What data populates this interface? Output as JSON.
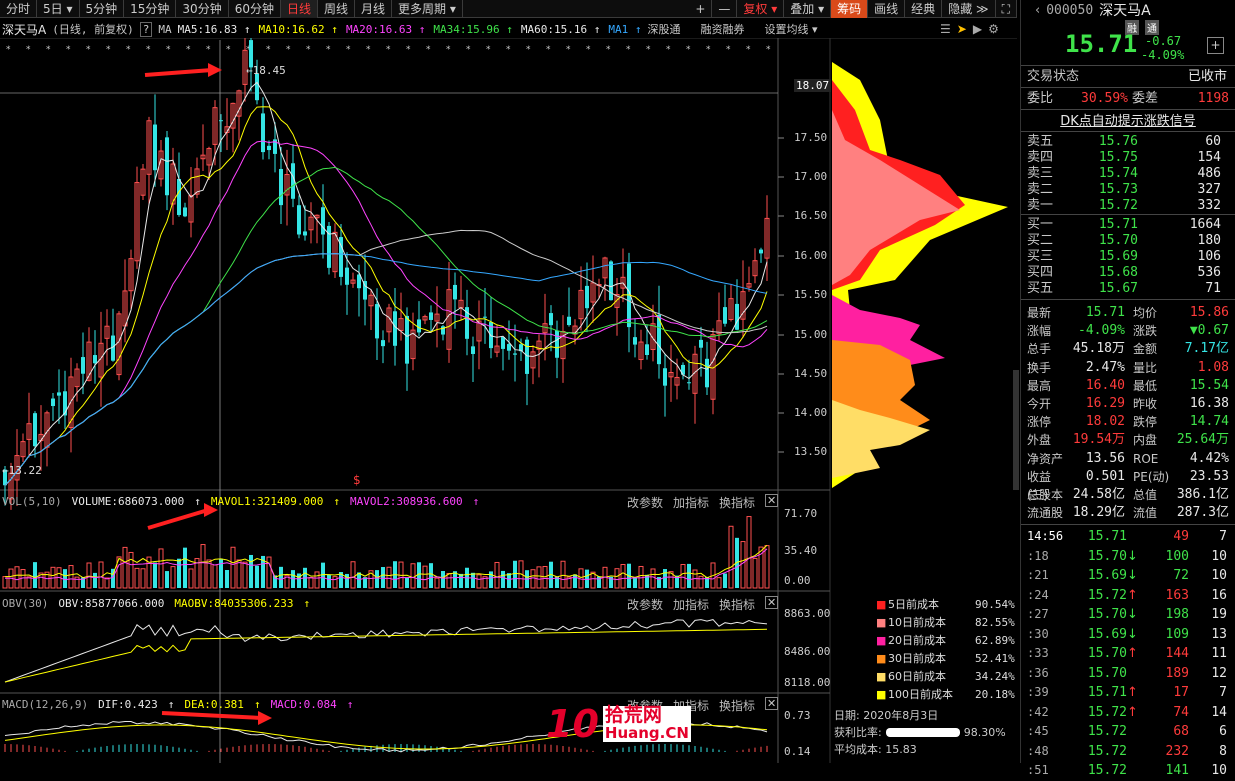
{
  "toolbar": {
    "items": [
      "分时",
      "5日",
      "5分钟",
      "15分钟",
      "30分钟",
      "60分钟",
      "日线",
      "周线",
      "月线",
      "更多周期"
    ],
    "active": "日线",
    "right": [
      "+",
      "—",
      "复权",
      "叠加",
      "筹码",
      "画线",
      "经典",
      "隐藏"
    ]
  },
  "stock": {
    "name": "深天马A",
    "code": "000050",
    "name_right": "深天马A",
    "badges": [
      "融",
      "通"
    ],
    "price": "15.71",
    "change": "-0.67",
    "change_pct": "-4.09%"
  },
  "info_row": {
    "mode": "(日线, 前复权)",
    "ma_label": "MA",
    "ma": [
      {
        "label": "MA5:16.83",
        "color": "#e8e8e8"
      },
      {
        "label": "MA10:16.62",
        "color": "#ffff00"
      },
      {
        "label": "MA20:16.63",
        "color": "#ff44ff"
      },
      {
        "label": "MA34:15.96",
        "color": "#3fe34a"
      },
      {
        "label": "MA60:15.16",
        "color": "#e8e8e8"
      },
      {
        "label": "MA1",
        "color": "#35a8ff"
      }
    ],
    "extra": [
      "深股通",
      "融资融券",
      "设置均线"
    ]
  },
  "price_axis": [
    "18.07",
    "17.50",
    "17.00",
    "16.50",
    "16.00",
    "15.50",
    "15.00",
    "14.50",
    "14.00",
    "13.50"
  ],
  "annotations": {
    "high": "18.45",
    "low": "13.22"
  },
  "vol": {
    "title": "VOL(5,10)",
    "volume": "VOLUME:686073.000",
    "mavol1": "MAVOL1:321409.000",
    "mavol2": "MAVOL2:308936.600",
    "axis": [
      "71.70",
      "35.40",
      "0.00"
    ]
  },
  "obv": {
    "title": "OBV(30)",
    "obv": "OBV:85877066.000",
    "maobv": "MAOBV:84035306.233",
    "axis": [
      "8863.00",
      "8486.00",
      "8118.00"
    ]
  },
  "macd": {
    "title": "MACD(12,26,9)",
    "dif": "DIF:0.423",
    "dea": "DEA:0.381",
    "macd": "MACD:0.084",
    "axis": [
      "0.73",
      "0.14"
    ]
  },
  "panel_buttons": [
    "改参数",
    "加指标",
    "换指标"
  ],
  "cost": {
    "items": [
      {
        "label": "5日前成本",
        "value": "90.54%",
        "color": "#ff2020"
      },
      {
        "label": "10日前成本",
        "value": "82.55%",
        "color": "#ff8080"
      },
      {
        "label": "20日前成本",
        "value": "62.89%",
        "color": "#ff20a0"
      },
      {
        "label": "30日前成本",
        "value": "52.41%",
        "color": "#ff8c1a"
      },
      {
        "label": "60日前成本",
        "value": "34.24%",
        "color": "#ffdd66"
      },
      {
        "label": "100日前成本",
        "value": "20.18%",
        "color": "#ffff00"
      }
    ],
    "date": "日期: 2020年8月3日",
    "profit_label": "获利比率:",
    "profit_value": "98.30%",
    "avg_cost": "平均成本: 15.83"
  },
  "status": {
    "label": "交易状态",
    "value": "已收市"
  },
  "weibi": {
    "l1": "委比",
    "v1": "30.59%",
    "l2": "委差",
    "v2": "1198"
  },
  "dk_signal": "DK点自动提示涨跌信号",
  "asks": [
    {
      "label": "卖五",
      "price": "15.76",
      "vol": "60"
    },
    {
      "label": "卖四",
      "price": "15.75",
      "vol": "154"
    },
    {
      "label": "卖三",
      "price": "15.74",
      "vol": "486"
    },
    {
      "label": "卖二",
      "price": "15.73",
      "vol": "327"
    },
    {
      "label": "卖一",
      "price": "15.72",
      "vol": "332"
    }
  ],
  "bids": [
    {
      "label": "买一",
      "price": "15.71",
      "vol": "1664"
    },
    {
      "label": "买二",
      "price": "15.70",
      "vol": "180"
    },
    {
      "label": "买三",
      "price": "15.69",
      "vol": "106"
    },
    {
      "label": "买四",
      "price": "15.68",
      "vol": "536"
    },
    {
      "label": "买五",
      "price": "15.67",
      "vol": "71"
    }
  ],
  "stats": [
    {
      "l1": "最新",
      "v1": "15.71",
      "c1": "green",
      "l2": "均价",
      "v2": "15.86",
      "c2": "red"
    },
    {
      "l1": "涨幅",
      "v1": "-4.09%",
      "c1": "green",
      "l2": "涨跌",
      "v2": "▼0.67",
      "c2": "green"
    },
    {
      "l1": "总手",
      "v1": "45.18万",
      "c1": "white",
      "l2": "金额",
      "v2": "7.17亿",
      "c2": "cyan"
    },
    {
      "l1": "换手",
      "v1": "2.47%",
      "c1": "white",
      "l2": "量比",
      "v2": "1.08",
      "c2": "red"
    },
    {
      "l1": "最高",
      "v1": "16.40",
      "c1": "red",
      "l2": "最低",
      "v2": "15.54",
      "c2": "green"
    },
    {
      "l1": "今开",
      "v1": "16.29",
      "c1": "red",
      "l2": "昨收",
      "v2": "16.38",
      "c2": "white"
    },
    {
      "l1": "涨停",
      "v1": "18.02",
      "c1": "red",
      "l2": "跌停",
      "v2": "14.74",
      "c2": "green"
    },
    {
      "l1": "外盘",
      "v1": "19.54万",
      "c1": "red",
      "l2": "内盘",
      "v2": "25.64万",
      "c2": "green"
    },
    {
      "l1": "净资产",
      "v1": "13.56",
      "c1": "white",
      "l2": "ROE",
      "v2": "4.42%",
      "c2": "white"
    },
    {
      "l1": "收益(三)",
      "v1": "0.501",
      "c1": "white",
      "l2": "PE(动)",
      "v2": "23.53",
      "c2": "white"
    },
    {
      "l1": "总股本",
      "v1": "24.58亿",
      "c1": "white",
      "l2": "总值",
      "v2": "386.1亿",
      "c2": "white"
    },
    {
      "l1": "流通股",
      "v1": "18.29亿",
      "c1": "white",
      "l2": "流值",
      "v2": "287.3亿",
      "c2": "white"
    }
  ],
  "ticks": [
    {
      "t": "14:56",
      "p": "15.71",
      "a": "",
      "v": "49",
      "n": "7",
      "pc": "green",
      "vc": "red"
    },
    {
      "t": ":18",
      "p": "15.70",
      "a": "↓",
      "v": "100",
      "n": "10",
      "pc": "green",
      "vc": "green"
    },
    {
      "t": ":21",
      "p": "15.69",
      "a": "↓",
      "v": "72",
      "n": "10",
      "pc": "green",
      "vc": "green"
    },
    {
      "t": ":24",
      "p": "15.72",
      "a": "↑",
      "v": "163",
      "n": "16",
      "pc": "green",
      "vc": "red"
    },
    {
      "t": ":27",
      "p": "15.70",
      "a": "↓",
      "v": "198",
      "n": "19",
      "pc": "green",
      "vc": "green"
    },
    {
      "t": ":30",
      "p": "15.69",
      "a": "↓",
      "v": "109",
      "n": "13",
      "pc": "green",
      "vc": "green"
    },
    {
      "t": ":33",
      "p": "15.70",
      "a": "↑",
      "v": "144",
      "n": "11",
      "pc": "green",
      "vc": "red"
    },
    {
      "t": ":36",
      "p": "15.70",
      "a": "",
      "v": "189",
      "n": "12",
      "pc": "green",
      "vc": "red"
    },
    {
      "t": ":39",
      "p": "15.71",
      "a": "↑",
      "v": "17",
      "n": "7",
      "pc": "green",
      "vc": "red"
    },
    {
      "t": ":42",
      "p": "15.72",
      "a": "↑",
      "v": "74",
      "n": "14",
      "pc": "green",
      "vc": "red"
    },
    {
      "t": ":45",
      "p": "15.72",
      "a": "",
      "v": "68",
      "n": "6",
      "pc": "green",
      "vc": "red"
    },
    {
      "t": ":48",
      "p": "15.72",
      "a": "",
      "v": "232",
      "n": "8",
      "pc": "green",
      "vc": "red"
    },
    {
      "t": ":51",
      "p": "15.72",
      "a": "",
      "v": "141",
      "n": "10",
      "pc": "green",
      "vc": "green"
    }
  ],
  "watermark": {
    "big": "10",
    "cn": "拾荒网",
    "en": "Huang.CN"
  }
}
